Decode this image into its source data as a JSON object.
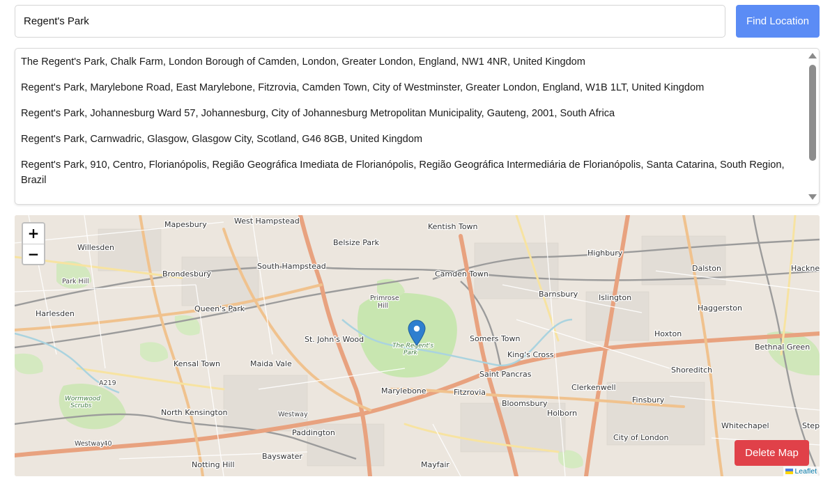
{
  "search": {
    "value": "Regent's Park",
    "button_label": "Find Location"
  },
  "results": [
    "The Regent's Park, Chalk Farm, London Borough of Camden, London, Greater London, England, NW1 4NR, United Kingdom",
    "Regent's Park, Marylebone Road, East Marylebone, Fitzrovia, Camden Town, City of Westminster, Greater London, England, W1B 1LT, United Kingdom",
    "Regent's Park, Johannesburg Ward 57, Johannesburg, City of Johannesburg Metropolitan Municipality, Gauteng, 2001, South Africa",
    "Regent's Park, Carnwadric, Glasgow, Glasgow City, Scotland, G46 8GB, United Kingdom",
    "Regent's Park, 910, Centro, Florianópolis, Região Geográfica Imediata de Florianópolis, Região Geográfica Intermediária de Florianópolis, Santa Catarina, South Region, Brazil"
  ],
  "map": {
    "zoom_in_label": "+",
    "zoom_out_label": "−",
    "delete_label": "Delete Map",
    "attribution": "Leaflet",
    "marker_icon": "map-marker-icon",
    "place_labels": {
      "mapesbury": "Mapesbury",
      "west_hampstead": "West Hampstead",
      "kentish_town": "Kentish Town",
      "belsize_park": "Belsize Park",
      "willesden": "Willesden",
      "highbury": "Highbury",
      "south_hampstead": "South Hampstead",
      "camden_town": "Camden Town",
      "dalston": "Dalston",
      "hackney": "Hackne",
      "brondesbury": "Brondesbury",
      "park_hill": "Park Hill",
      "primrose_hill": "Primrose",
      "primrose_hill_2": "Hill",
      "barnsbury": "Barnsbury",
      "islington": "Islington",
      "queens_park": "Queen's Park",
      "harlesden": "Harlesden",
      "haggerston": "Haggerston",
      "the_regents_park": "The Regent's",
      "the_regents_park_2": "Park",
      "st_johns_wood": "St. John's Wood",
      "somers_town": "Somers Town",
      "hoxton": "Hoxton",
      "bethnal_green": "Bethnal Green",
      "kings_cross": "King's Cross",
      "kensal_town": "Kensal Town",
      "maida_vale": "Maida Vale",
      "shoreditch": "Shoreditch",
      "saint_pancras": "Saint Pancras",
      "clerkenwell": "Clerkenwell",
      "marylebone": "Marylebone",
      "fitzrovia": "Fitzrovia",
      "bloomsbury": "Bloomsbury",
      "finsbury": "Finsbury",
      "wormwood_scrubs": "Wormwood",
      "wormwood_scrubs_2": "Scrubs",
      "north_kensington": "North Kensington",
      "holborn": "Holborn",
      "whitechapel": "Whitechapel",
      "stepney": "Step",
      "paddington": "Paddington",
      "city_of_london": "City of London",
      "notting_hill": "Notting Hill",
      "bayswater": "Bayswater",
      "mayfair": "Mayfair",
      "a219": "A219",
      "a40": "A40",
      "westway": "Westway",
      "westway_2": "Westway"
    }
  },
  "colors": {
    "find_button": "#5b8cf5",
    "delete_button": "#e04149",
    "marker": "#2e7fcf",
    "park": "#c8e6b0",
    "map_bg": "#eae4dc"
  }
}
